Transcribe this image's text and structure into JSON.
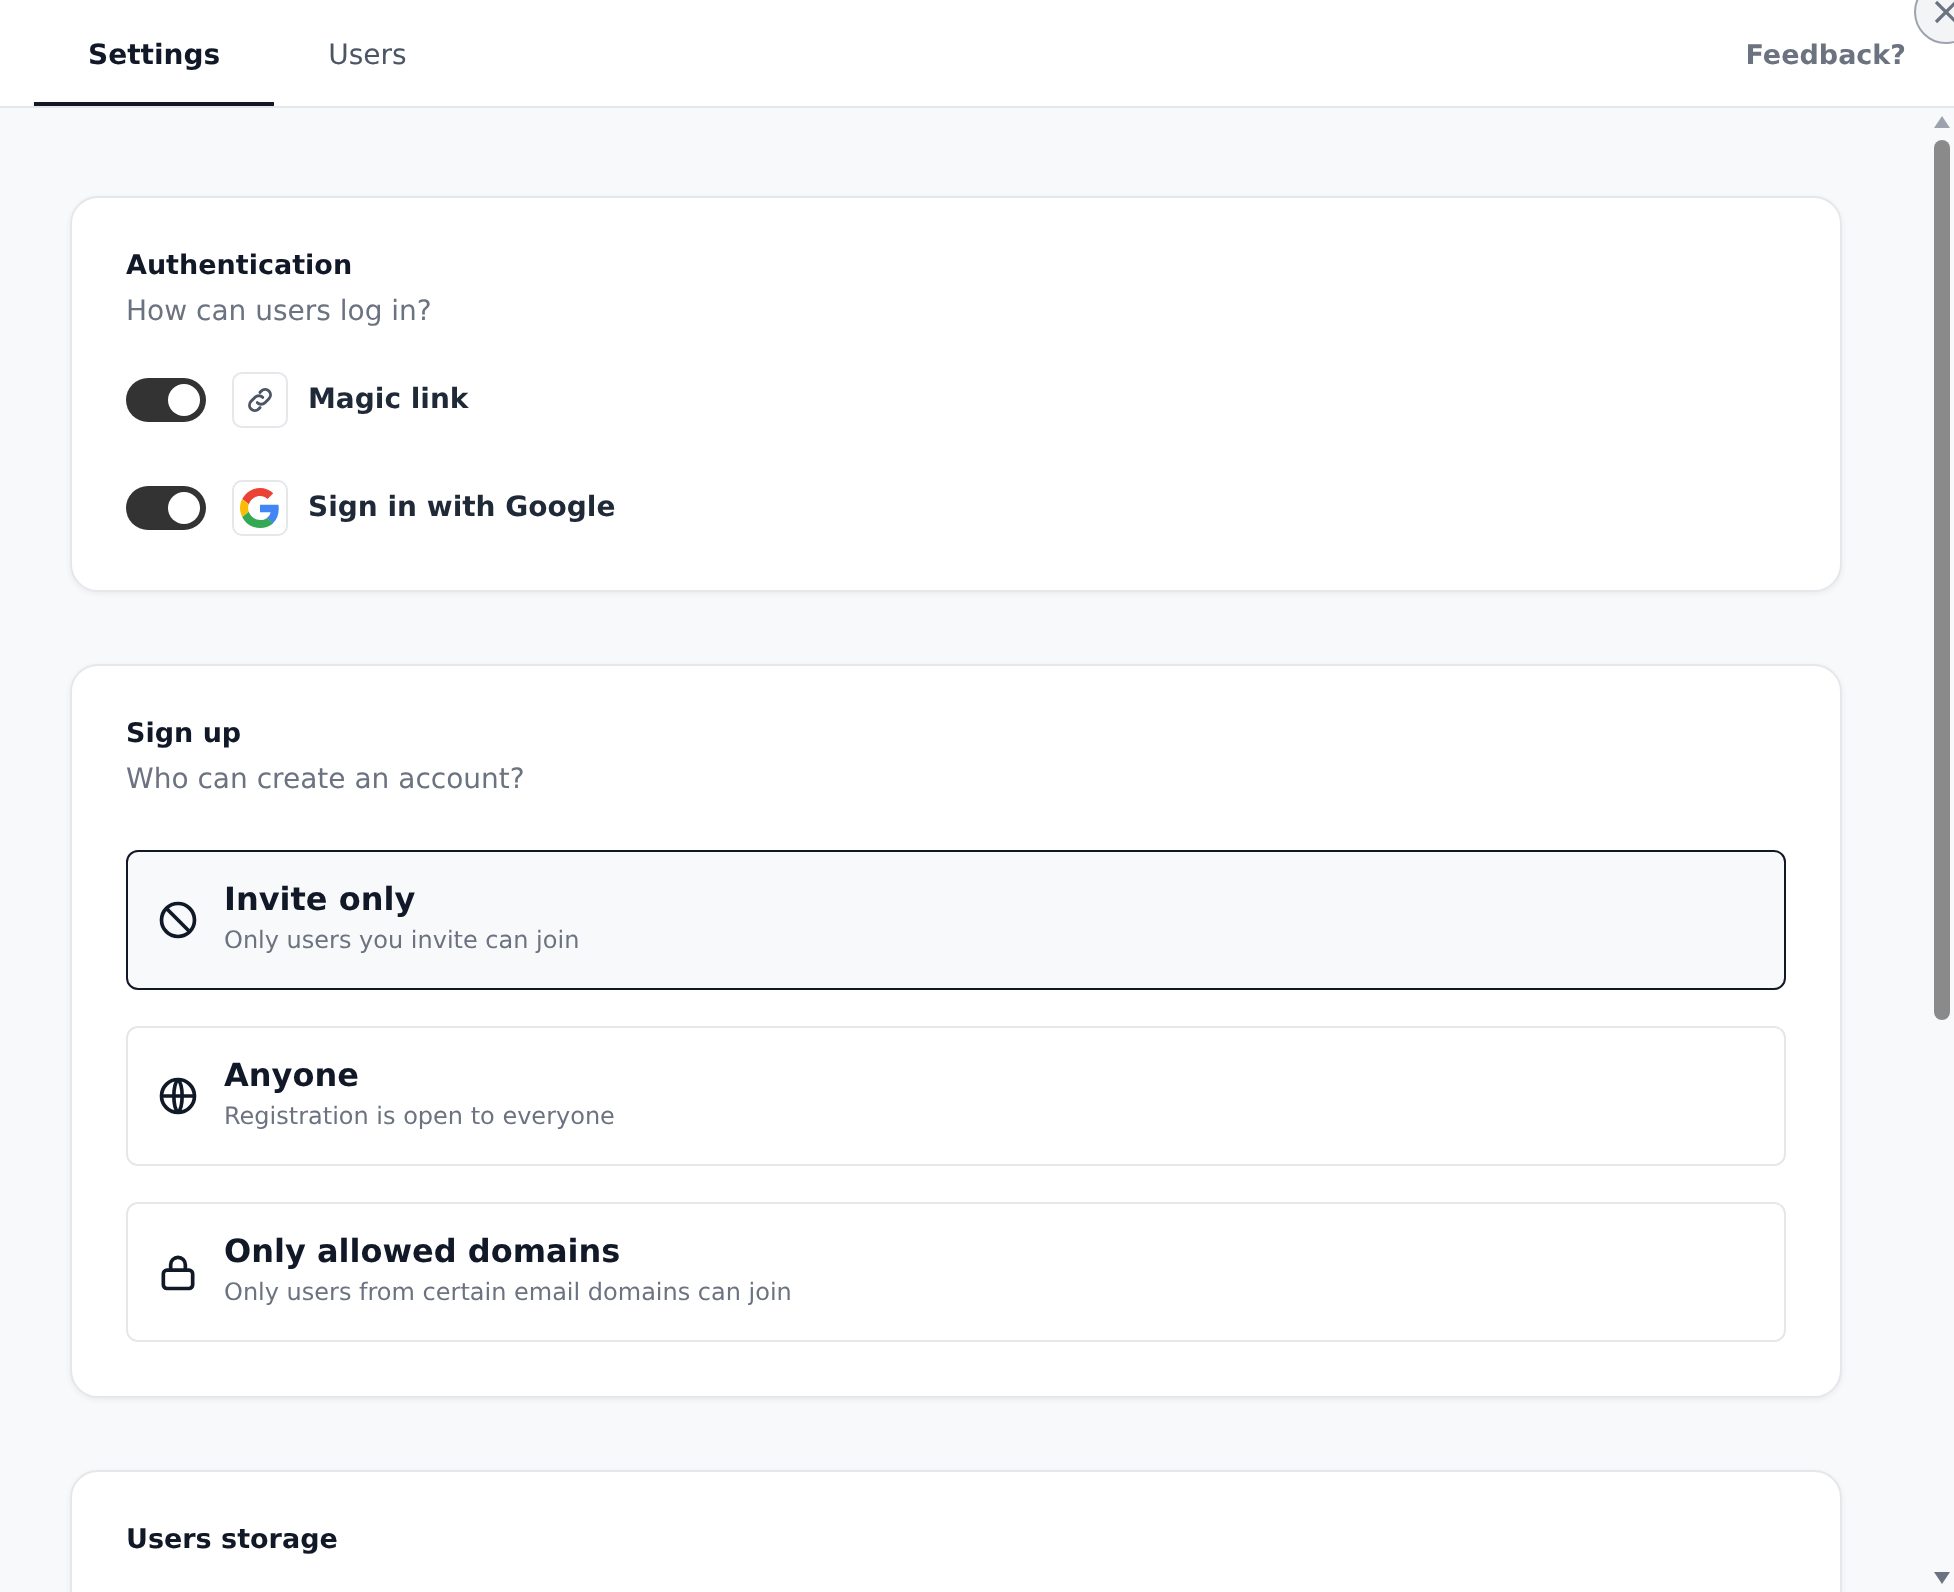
{
  "tabs": [
    {
      "label": "Settings",
      "selected": true
    },
    {
      "label": "Users",
      "selected": false
    }
  ],
  "feedback": "Feedback?",
  "authentication": {
    "title": "Authentication",
    "subtitle": "How can users log in?",
    "methods": [
      {
        "label": "Magic link",
        "on": true,
        "kind": "link"
      },
      {
        "label": "Sign in with Google",
        "on": true,
        "kind": "google"
      }
    ]
  },
  "sign_up": {
    "title": "Sign up",
    "subtitle": "Who can create an account?",
    "options": [
      {
        "title": "Invite only",
        "description": "Only users you invite can join",
        "selected": true,
        "kind": "ban"
      },
      {
        "title": "Anyone",
        "description": "Registration is open to everyone",
        "selected": false,
        "kind": "globe"
      },
      {
        "title": "Only allowed domains",
        "description": "Only users from certain email domains can join",
        "selected": false,
        "kind": "lock"
      }
    ]
  },
  "users_storage": {
    "title": "Users storage"
  }
}
